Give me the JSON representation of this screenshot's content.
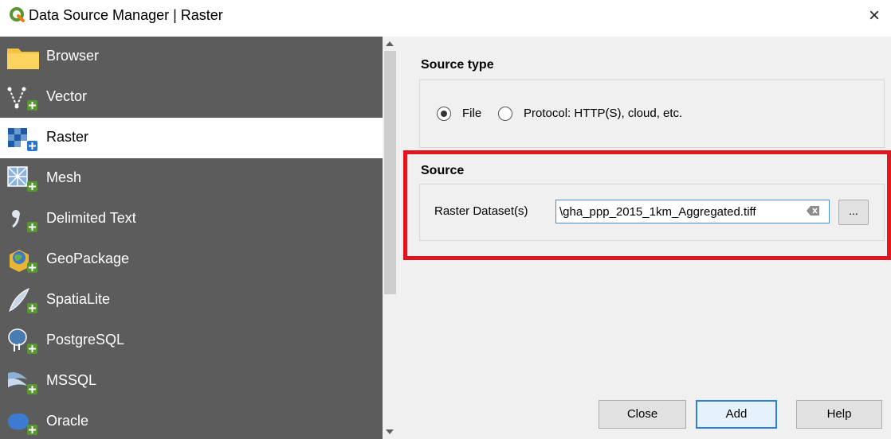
{
  "window": {
    "title": "Data Source Manager | Raster",
    "close_glyph": "×"
  },
  "sidebar": {
    "items": [
      {
        "label": "Browser",
        "icon": "folder-icon"
      },
      {
        "label": "Vector",
        "icon": "vector-icon"
      },
      {
        "label": "Raster",
        "icon": "raster-icon",
        "active": true
      },
      {
        "label": "Mesh",
        "icon": "mesh-icon"
      },
      {
        "label": "Delimited Text",
        "icon": "delimited-text-icon"
      },
      {
        "label": "GeoPackage",
        "icon": "geopackage-icon"
      },
      {
        "label": "SpatiaLite",
        "icon": "spatialite-icon"
      },
      {
        "label": "PostgreSQL",
        "icon": "postgresql-icon"
      },
      {
        "label": "MSSQL",
        "icon": "mssql-icon"
      },
      {
        "label": "Oracle",
        "icon": "oracle-icon"
      }
    ]
  },
  "source_type": {
    "heading": "Source type",
    "options": [
      {
        "label": "File",
        "selected": true
      },
      {
        "label": "Protocol: HTTP(S), cloud, etc.",
        "selected": false
      }
    ]
  },
  "source": {
    "heading": "Source",
    "field_label": "Raster Dataset(s)",
    "value": "\\gha_ppp_2015_1km_Aggregated.tiff",
    "browse_label": "..."
  },
  "buttons": {
    "close": "Close",
    "add": "Add",
    "help": "Help"
  },
  "colors": {
    "sidebar_bg": "#5c5c5c",
    "highlight": "#e0161e",
    "qgis_green": "#589632"
  }
}
